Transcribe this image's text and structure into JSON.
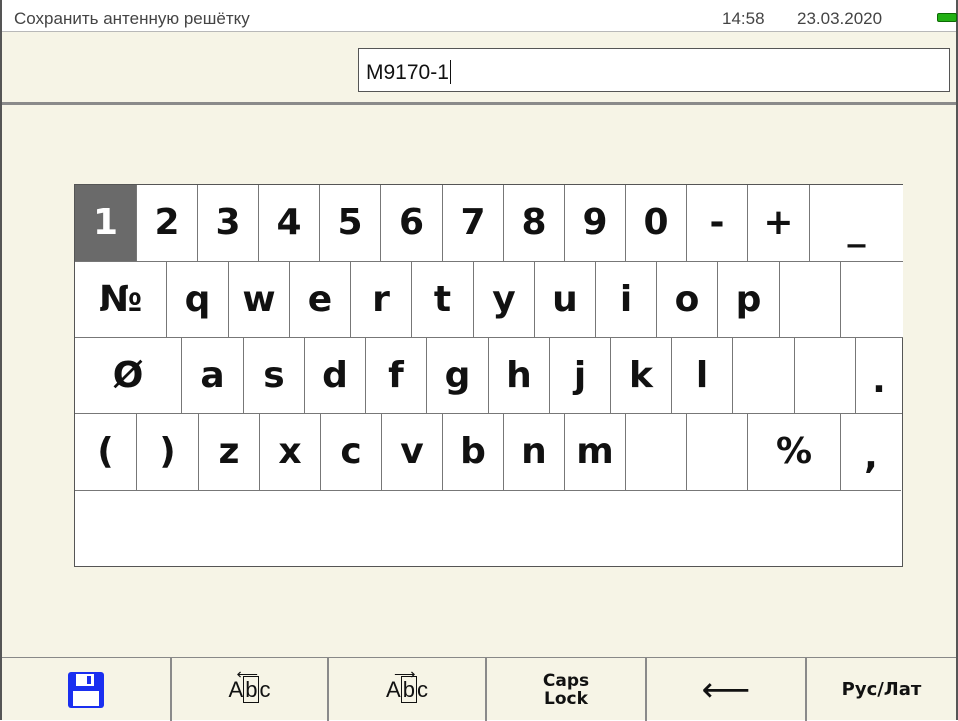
{
  "status": {
    "title": "Сохранить антенную решётку",
    "time": "14:58",
    "date": "23.03.2020",
    "battery_color": "#22b014"
  },
  "input": {
    "value": "M9170-1"
  },
  "keyboard": {
    "row1": [
      "1",
      "2",
      "3",
      "4",
      "5",
      "6",
      "7",
      "8",
      "9",
      "0",
      "-",
      "+",
      "_"
    ],
    "row2": [
      "№",
      "q",
      "w",
      "e",
      "r",
      "t",
      "y",
      "u",
      "i",
      "o",
      "p",
      "",
      ""
    ],
    "row3": [
      "Ø",
      "a",
      "s",
      "d",
      "f",
      "g",
      "h",
      "j",
      "k",
      "l",
      "",
      "",
      "."
    ],
    "row4": [
      "(",
      ")",
      "z",
      "x",
      "c",
      "v",
      "b",
      "n",
      "m",
      "",
      "",
      "%",
      ","
    ],
    "active_key": "1",
    "space_label": ""
  },
  "toolbar": {
    "save_icon": "floppy-disk-icon",
    "cursor_left_label": "Abc",
    "cursor_right_label": "Abc",
    "caps_lock_label": "Caps\nLock",
    "backspace_icon": "left-arrow-icon",
    "backspace_glyph": "⟵",
    "lang_label": "Рус/Лат"
  },
  "colors": {
    "background": "#f6f4e6",
    "active_key": "#6a6a6a",
    "save_icon_blue": "#1a2ff0"
  }
}
